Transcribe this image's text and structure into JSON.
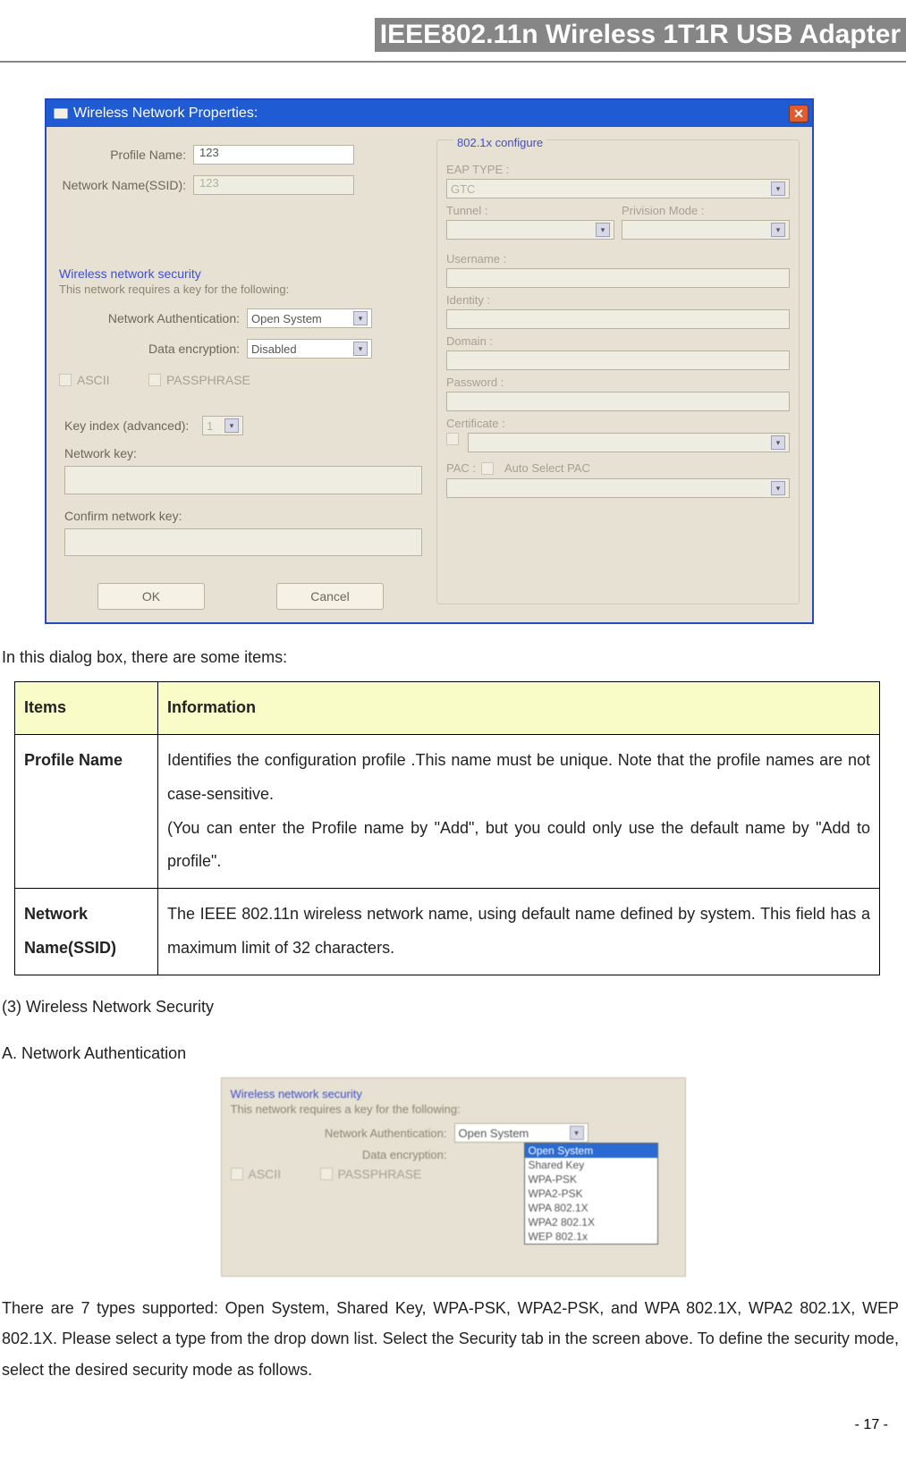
{
  "header": {
    "banner": "IEEE802.11n Wireless 1T1R USB Adapter"
  },
  "dialog": {
    "title": "Wireless Network Properties:",
    "left": {
      "profile_name_label": "Profile Name:",
      "profile_name_value": "123",
      "ssid_label": "Network Name(SSID):",
      "ssid_value": "123",
      "security_title": "Wireless network security",
      "security_sub": "This network requires a key for the following:",
      "net_auth_label": "Network Authentication:",
      "net_auth_value": "Open System",
      "data_enc_label": "Data encryption:",
      "data_enc_value": "Disabled",
      "ascii_label": "ASCII",
      "passphrase_label": "PASSPHRASE",
      "key_index_label": "Key index (advanced):",
      "key_index_value": "1",
      "network_key_label": "Network key:",
      "confirm_key_label": "Confirm network key:",
      "ok_label": "OK",
      "cancel_label": "Cancel"
    },
    "right": {
      "section_title": "802.1x configure",
      "eap_type_label": "EAP TYPE :",
      "eap_type_value": "GTC",
      "tunnel_label": "Tunnel :",
      "privision_label": "Privision Mode :",
      "username_label": "Username :",
      "identity_label": "Identity :",
      "domain_label": "Domain :",
      "password_label": "Password :",
      "certificate_label": "Certificate :",
      "pac_label": "PAC :",
      "auto_pac_label": "Auto Select PAC"
    }
  },
  "body": {
    "intro": "In this dialog box, there are some items:",
    "table": {
      "h_items": "Items",
      "h_info": "Information",
      "r1_item": "Profile Name",
      "r1_info_line1": "Identifies the configuration profile .This name must be unique. Note that the profile names are not case-sensitive.",
      "r1_info_line2": "(You can enter the Profile name by \"Add\", but you could only use the default name by \"Add to profile\".",
      "r2_item": "Network Name(SSID)",
      "r2_info": "The IEEE 802.11n wireless network name, using default name defined by system. This field has a maximum limit of 32 characters."
    },
    "sec_heading": " (3) Wireless Network Security",
    "sec_sub_a": "A. Network Authentication",
    "sec_figure": {
      "title": "Wireless network security",
      "sub": "This network requires a key for the following:",
      "net_auth_label": "Network Authentication:",
      "net_auth_value": "Open System",
      "data_enc_label": "Data encryption:",
      "ascii": "ASCII",
      "passphrase": "PASSPHRASE",
      "options": [
        "Open System",
        "Shared Key",
        "WPA-PSK",
        "WPA2-PSK",
        "WPA 802.1X",
        "WPA2 802.1X",
        "WEP 802.1x"
      ]
    },
    "sec_para": "There are 7 types supported: Open System, Shared Key, WPA-PSK, WPA2-PSK, and WPA 802.1X, WPA2 802.1X, WEP 802.1X. Please select a type from the drop down list. Select the Security tab in the screen above. To define the security mode, select the desired security mode as follows."
  },
  "footer": {
    "page": "- 17 -"
  }
}
